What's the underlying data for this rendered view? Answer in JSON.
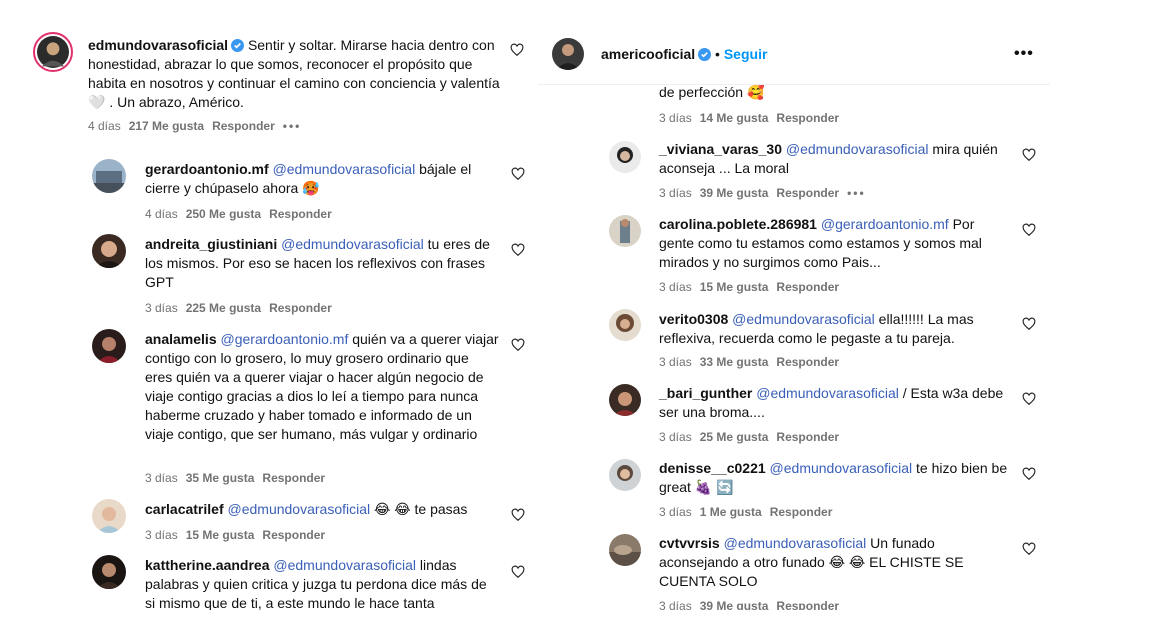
{
  "colors": {
    "mention": "#3a5fb8",
    "follow": "#0095f6",
    "meta": "#737373",
    "verified": "#3897f0"
  },
  "left": {
    "post": {
      "username": "edmundovarasoficial",
      "caption": "Sentir y soltar. Mirarse hacia dentro con honestidad, abrazar lo que somos, reconocer el propósito que habita en nosotros y continuar el camino con conciencia y valentía 🤍 . Un abrazo, Américo.",
      "time": "4 días",
      "likes": "217 Me gusta",
      "reply": "Responder",
      "more": "•••"
    },
    "comments": [
      {
        "username": "gerardoantonio.mf",
        "mention": "@edmundovarasoficial",
        "text": " bájale el cierre y chúpaselo ahora 🥵",
        "time": "4 días",
        "likes": "250 Me gusta",
        "reply": "Responder"
      },
      {
        "username": "andreita_giustiniani",
        "mention": "@edmundovarasoficial",
        "text": " tu eres de los mismos. Por eso se hacen los reflexivos con frases GPT",
        "time": "3 días",
        "likes": "225 Me gusta",
        "reply": "Responder"
      },
      {
        "username": "analamelis",
        "mention": "@gerardoantonio.mf",
        "text": " quién va a querer viajar contigo con lo grosero, lo muy grosero ordinario que eres quién va a querer viajar o hacer algún negocio de viaje contigo gracias a dios lo leí a tiempo para nunca haberme cruzado y haber tomado e informado de un viaje contigo, que ser humano, más vulgar y ordinario",
        "time": "3 días",
        "likes": "35 Me gusta",
        "reply": "Responder"
      },
      {
        "username": "carlacatrilef",
        "mention": "@edmundovarasoficial",
        "text": " 😂 😂  te pasas",
        "time": "3 días",
        "likes": "15 Me gusta",
        "reply": "Responder"
      },
      {
        "username": "kattherine.aandrea",
        "mention": "@edmundovarasoficial",
        "text": " lindas palabras y quien critica y juzga tu perdona dice más de si mismo que de ti, a este mundo le hace tanta",
        "time": "",
        "likes": "",
        "reply": ""
      }
    ]
  },
  "right": {
    "header": {
      "username": "americooficial",
      "separator": "•",
      "follow": "Seguir",
      "more": "•••"
    },
    "partial": {
      "text": "de perfección 🥰",
      "time": "3 días",
      "likes": "14 Me gusta",
      "reply": "Responder"
    },
    "comments": [
      {
        "username": "_viviana_varas_30",
        "mention": "@edmundovarasoficial",
        "text": " mira quién aconseja ... La moral",
        "time": "3 días",
        "likes": "39 Me gusta",
        "reply": "Responder",
        "more": "•••"
      },
      {
        "username": "carolina.poblete.286981",
        "mention": "@gerardoantonio.mf",
        "text": " Por gente como tu estamos como estamos y somos mal mirados y no surgimos como Pais...",
        "time": "3 días",
        "likes": "15 Me gusta",
        "reply": "Responder"
      },
      {
        "username": "verito0308",
        "mention": "@edmundovarasoficial",
        "text": " ella!!!!!! La mas reflexiva, recuerda como le pegaste a tu pareja.",
        "time": "3 días",
        "likes": "33 Me gusta",
        "reply": "Responder"
      },
      {
        "username": "_bari_gunther",
        "mention": "@edmundovarasoficial",
        "text": " / Esta w3a debe ser una broma....",
        "time": "3 días",
        "likes": "25 Me gusta",
        "reply": "Responder"
      },
      {
        "username": "denisse__c0221",
        "mention": "@edmundovarasoficial",
        "text": " te hizo bien be great 🍇 🔄",
        "time": "3 días",
        "likes": "1 Me gusta",
        "reply": "Responder"
      },
      {
        "username": "cvtvvrsis",
        "mention": "@edmundovarasoficial",
        "text": " Un funado aconsejando a otro funado 😂 😂  EL CHISTE SE CUENTA SOLO",
        "time": "3 días",
        "likes": "39 Me gusta",
        "reply": "Responder"
      }
    ]
  }
}
